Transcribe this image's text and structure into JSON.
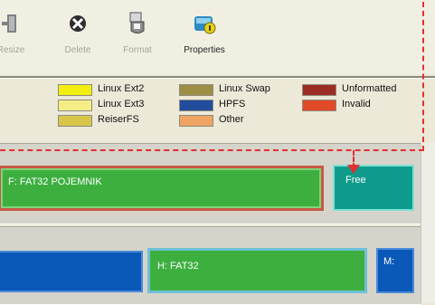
{
  "toolbar": {
    "buttons": [
      {
        "label": "Resize",
        "icon": "resize-icon",
        "enabled": false
      },
      {
        "label": "Delete",
        "icon": "delete-icon",
        "enabled": false
      },
      {
        "label": "Format",
        "icon": "format-icon",
        "enabled": false
      },
      {
        "label": "Properties",
        "icon": "properties-icon",
        "enabled": true
      }
    ]
  },
  "legend": [
    {
      "label": "Linux Ext2",
      "color": "#f2ee10"
    },
    {
      "label": "Linux Ext3",
      "color": "#f5ee86"
    },
    {
      "label": "ReiserFS",
      "color": "#d8c64a"
    },
    {
      "label": "Linux Swap",
      "color": "#9d8e45"
    },
    {
      "label": "HPFS",
      "color": "#224c9c"
    },
    {
      "label": "Other",
      "color": "#efa464"
    },
    {
      "label": "Unformatted",
      "color": "#9c2d25"
    },
    {
      "label": "Invalid",
      "color": "#e04a28"
    }
  ],
  "disk1": {
    "partitions": [
      {
        "label": "F:  FAT32  POJEMNIK",
        "color": "#3daf3f",
        "selected": true
      },
      {
        "label": "Free",
        "color": "#0f9b8b"
      }
    ]
  },
  "disk2": {
    "partitions": [
      {
        "label": "",
        "color": "#0a58b8"
      },
      {
        "label": "H:  FAT32",
        "color": "#3daf3f"
      },
      {
        "label": "M:",
        "color": "#0a58b8"
      }
    ]
  }
}
